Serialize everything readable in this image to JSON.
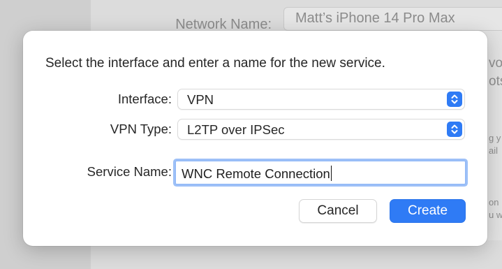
{
  "background": {
    "network_name_label": "Network Name:",
    "network_name_value": "Matt’s iPhone 14 Pro Max",
    "fragments": [
      "vo",
      "ots",
      "g y",
      "ail",
      "on",
      "u w"
    ]
  },
  "dialog": {
    "prompt": "Select the interface and enter a name for the new service.",
    "interface": {
      "label": "Interface:",
      "value": "VPN"
    },
    "vpn_type": {
      "label": "VPN Type:",
      "value": "L2TP over IPSec"
    },
    "service_name": {
      "label": "Service Name:",
      "value": "WNC Remote Connection"
    },
    "buttons": {
      "cancel": "Cancel",
      "create": "Create"
    }
  },
  "icons": {
    "popup_stepper": "chevron-up-down-icon"
  },
  "colors": {
    "accent": "#2f7bf5",
    "focus_ring": "#9dc0f7"
  }
}
